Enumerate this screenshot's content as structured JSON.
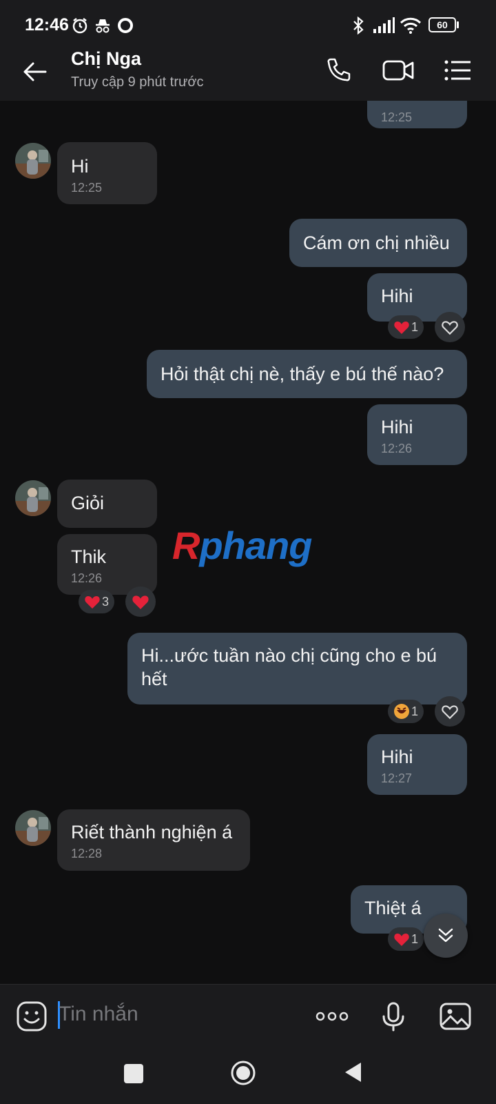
{
  "status_bar": {
    "time": "12:46",
    "battery": "60"
  },
  "header": {
    "contact_name": "Chị Nga",
    "status": "Truy cập 9 phút trước"
  },
  "messages": [
    {
      "dir": "out",
      "time": "12:25"
    },
    {
      "dir": "in",
      "text": "Hi",
      "time": "12:25"
    },
    {
      "dir": "out",
      "text": "Cám ơn chị nhiều"
    },
    {
      "dir": "out",
      "text": "Hihi",
      "reaction": {
        "emoji": "heart",
        "count": "1"
      }
    },
    {
      "dir": "out",
      "text": "Hỏi thật chị nè, thấy e bú thế nào?"
    },
    {
      "dir": "out",
      "text": "Hihi",
      "time": "12:26"
    },
    {
      "dir": "in",
      "text": "Giỏi"
    },
    {
      "dir": "in",
      "text": "Thik",
      "time": "12:26",
      "reaction": {
        "emoji": "heart",
        "count": "3"
      }
    },
    {
      "dir": "out",
      "text_line1": "Hi...ước tuần nào chị cũng cho e bú",
      "text_line2": "hết",
      "reaction": {
        "emoji": "laugh",
        "count": "1"
      }
    },
    {
      "dir": "out",
      "text": "Hihi",
      "time": "12:27"
    },
    {
      "dir": "in",
      "text": "Riết thành nghiện á",
      "time": "12:28"
    },
    {
      "dir": "out",
      "text": "Thiệt á",
      "reaction": {
        "emoji": "heart",
        "count": "1"
      }
    }
  ],
  "watermark": {
    "part1": "R",
    "part2": "phang",
    "color1": "#d8262c",
    "color2": "#1e6fc7"
  },
  "composer": {
    "placeholder": "Tin nhắn"
  },
  "colors": {
    "background": "#0f0f10",
    "incoming": "#2a2a2c",
    "outgoing": "#3a4653",
    "accent": "#2e8fff"
  }
}
